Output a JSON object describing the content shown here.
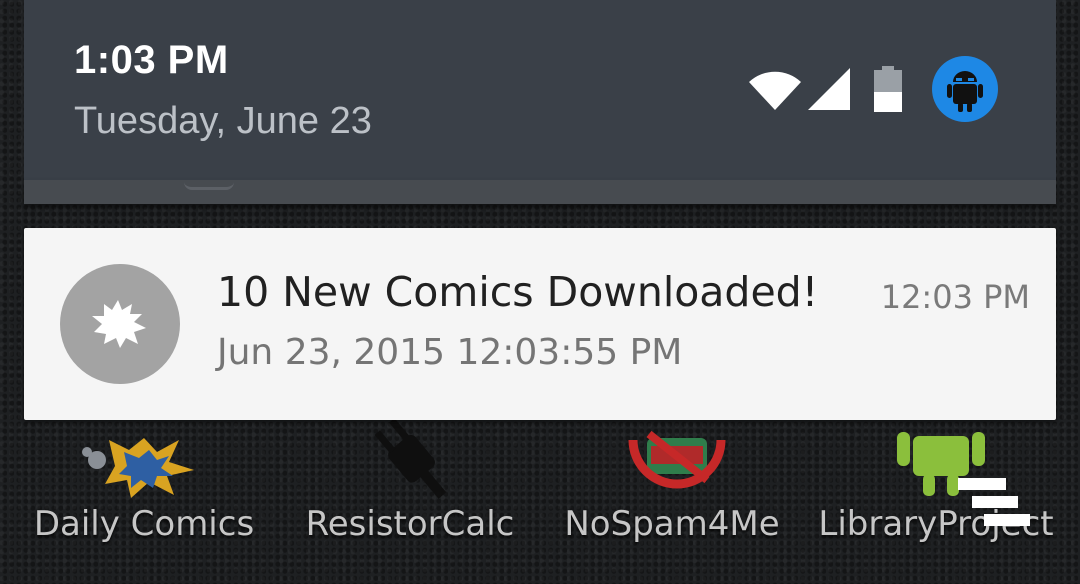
{
  "status_bar": {
    "time": "1:03 PM",
    "date": "Tuesday, June 23",
    "icons": [
      "wifi-icon",
      "signal-icon",
      "battery-icon",
      "user-avatar-android"
    ],
    "avatar_bg": "#1e88e5"
  },
  "notification": {
    "title": "10 New Comics Downloaded!",
    "text": "Jun 23, 2015 12:03:55 PM",
    "time": "12:03 PM",
    "icon": "comic-burst-icon",
    "icon_bg": "#a3a3a3"
  },
  "launcher": {
    "apps": [
      {
        "label": "Daily Comics",
        "icon": "comic-burst-app-icon"
      },
      {
        "label": "ResistorCalc",
        "icon": "plug-app-icon"
      },
      {
        "label": "NoSpam4Me",
        "icon": "no-spam-app-icon"
      },
      {
        "label": "LibraryProject",
        "icon": "android-app-icon"
      }
    ]
  },
  "watermark": "watermark-logo"
}
